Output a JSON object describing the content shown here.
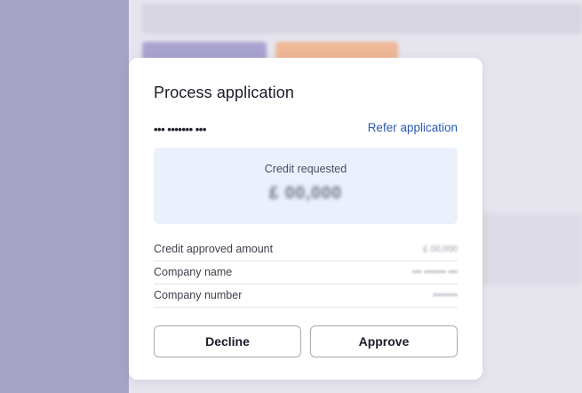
{
  "modal": {
    "title": "Process application",
    "application_id": "••• ••••••• •••",
    "refer_link": "Refer application",
    "credit": {
      "label": "Credit requested",
      "value": "£ 00,000"
    },
    "details": [
      {
        "label": "Credit approved amount",
        "value": "£ 00,000"
      },
      {
        "label": "Company name",
        "value": "••• ••••••• •••"
      },
      {
        "label": "Company number",
        "value": "••••••••"
      }
    ],
    "buttons": {
      "decline": "Decline",
      "approve": "Approve"
    }
  },
  "colors": {
    "link": "#2a5ab3",
    "credit_box_bg": "#ebf0fc",
    "sidebar_bg": "#a7a3c6"
  }
}
